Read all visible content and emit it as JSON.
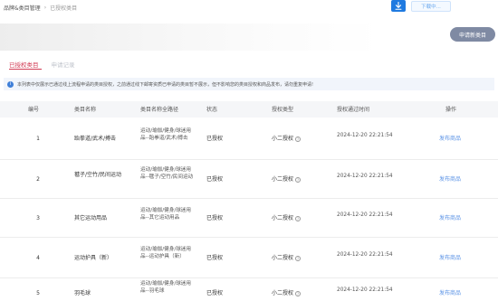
{
  "breadcrumb": {
    "parent": "品牌&类目管理",
    "separator": "›",
    "current": "已授权类目"
  },
  "toolbar": {
    "download_label": "下载中..."
  },
  "actions": {
    "apply_label": "申请新类目"
  },
  "tabs": [
    {
      "label": "已授权类目",
      "active": true
    },
    {
      "label": "申请记录",
      "active": false
    }
  ],
  "notice": {
    "text": "本列表中仅展示已通过线上流程申请的类目授权，之前通过线下邮寄资质已申请的类目暂不展示，但不影响您的类目授权和商品发布，请勿重复申请!"
  },
  "table": {
    "headers": [
      "编号",
      "类目名称",
      "类目名称全路径",
      "状态",
      "授权类型",
      "授权通过时间",
      "操作"
    ],
    "rows": [
      {
        "idx": "1",
        "name": "跆拳道/武术/搏击",
        "path": "运动/瑜伽/健身/球迷用品--跆拳道/武术/搏击",
        "status": "已授权",
        "type": "小二授权",
        "time": "2024-12-20 22:21:54",
        "action": "发布商品"
      },
      {
        "idx": "2",
        "name": "毽子/空竹/民间运动",
        "path": "运动/瑜伽/健身/球迷用品--毽子/空竹/民间运动",
        "status": "已授权",
        "type": "小二授权",
        "time": "2024-12-20 22:21:54",
        "action": "发布商品"
      },
      {
        "idx": "3",
        "name": "其它运动用品",
        "path": "运动/瑜伽/健身/球迷用品--其它运动用品",
        "status": "已授权",
        "type": "小二授权",
        "time": "2024-12-20 22:21:54",
        "action": "发布商品"
      },
      {
        "idx": "4",
        "name": "运动护具（新）",
        "path": "运动/瑜伽/健身/球迷用品--运动护具（新）",
        "status": "已授权",
        "type": "小二授权",
        "time": "2024-12-20 22:21:54",
        "action": "发布商品"
      },
      {
        "idx": "5",
        "name": "羽毛球",
        "path": "运动/瑜伽/健身/球迷用品--羽毛球",
        "status": "已授权",
        "type": "小二授权",
        "time": "2024-12-20 22:21:54",
        "action": "发布商品"
      }
    ]
  },
  "colors": {
    "accent_red": "#d23b54",
    "link_blue": "#5b93e6",
    "primary_blue": "#1f7ae0",
    "apply_button_gray": "#7f8aa3",
    "info_blue": "#3f7fd8"
  },
  "icons": {
    "download": "download-arrow-icon",
    "info": "info-icon",
    "help": "question-circle-icon"
  }
}
